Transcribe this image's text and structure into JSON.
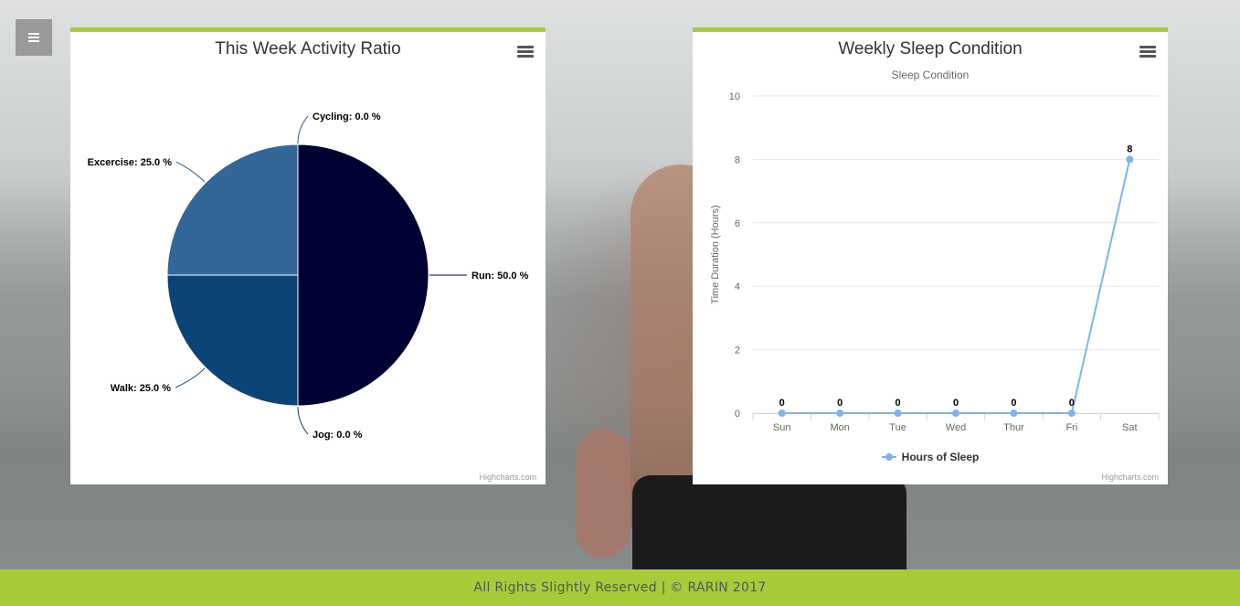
{
  "menu": {
    "icon": "hamburger-menu-icon"
  },
  "activity_panel": {
    "title": "This Week Activity Ratio",
    "menu_icon": "chart-context-menu-icon",
    "credits": "Highcharts.com",
    "accent": "#a6cc39"
  },
  "sleep_panel": {
    "title": "Weekly Sleep Condition",
    "menu_icon": "chart-context-menu-icon",
    "credits": "Highcharts.com",
    "accent": "#a6cc39"
  },
  "footer": {
    "text": "All Rights Slightly Reserved | © RARIN 2017",
    "background": "#a6cc39"
  },
  "chart_data": [
    {
      "type": "pie",
      "title": "This Week Activity Ratio",
      "slices": [
        {
          "name": "Run",
          "value": 50.0,
          "label": "Run: 50.0 %",
          "color": "#000033"
        },
        {
          "name": "Jog",
          "value": 0.0,
          "label": "Jog: 0.0 %",
          "color": "#0a3b6e"
        },
        {
          "name": "Walk",
          "value": 25.0,
          "label": "Walk: 25.0 %",
          "color": "#0d4478"
        },
        {
          "name": "Excercise",
          "value": 25.0,
          "label": "Excercise: 25.0 %",
          "color": "#336799"
        },
        {
          "name": "Cycling",
          "value": 0.0,
          "label": "Cycling: 0.0 %",
          "color": "#2a5d8f"
        }
      ]
    },
    {
      "type": "line",
      "title": "Weekly Sleep Condition",
      "subtitle": "Sleep Condition",
      "categories": [
        "Sun",
        "Mon",
        "Tue",
        "Wed",
        "Thur",
        "Fri",
        "Sat"
      ],
      "series": [
        {
          "name": "Hours of Sleep",
          "values": [
            0,
            0,
            0,
            0,
            0,
            0,
            8
          ],
          "color": "#7cb5ec"
        }
      ],
      "xlabel": "",
      "ylabel": "Time Duration (Hours)",
      "ylim": [
        0,
        10
      ],
      "yticks": [
        0,
        2,
        4,
        6,
        8,
        10
      ],
      "grid": true,
      "legend": "bottom-center"
    }
  ]
}
